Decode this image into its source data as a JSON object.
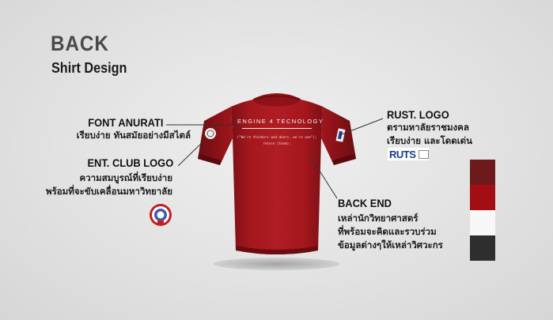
{
  "page": {
    "title": "BACK",
    "subtitle": "Shirt Design"
  },
  "annotations": {
    "font": {
      "heading": "FONT ANURATI",
      "lines": [
        "เรียบง่าย ทันสมัยอย่างมีสไตล์"
      ]
    },
    "ent_logo": {
      "heading": "ENT. CLUB LOGO",
      "lines": [
        "ความสมบูรณ์ที่เรียบง่าย",
        "พร้อมที่จะขับเคลื่อนมหาวิทยาลัย"
      ]
    },
    "rust_logo": {
      "heading": "RUST. LOGO",
      "lines": [
        "ตรามหาลัยราชมงคล",
        "เรียบง่าย และโดดเด่น"
      ]
    },
    "back_end": {
      "heading": "BACK END",
      "lines": [
        "เหล่านักวิทยาศาสตร์",
        "ที่พร้อมจะคิดและรวบร่วม",
        "ข้อมูลต่างๆให้เหล่าวิศวะกร"
      ]
    }
  },
  "shirt": {
    "print_title": "ENGINE 4 TECNOLOGY",
    "print_line1": "(\"We're thinkers and doers, we're one\");",
    "print_line2": "return (team);",
    "color": "#a01c22"
  },
  "badges": {
    "ruts_text": "RUTS"
  },
  "palette": [
    "#6e1a1c",
    "#a30e15",
    "#f7f7f7",
    "#2e2e2e"
  ]
}
